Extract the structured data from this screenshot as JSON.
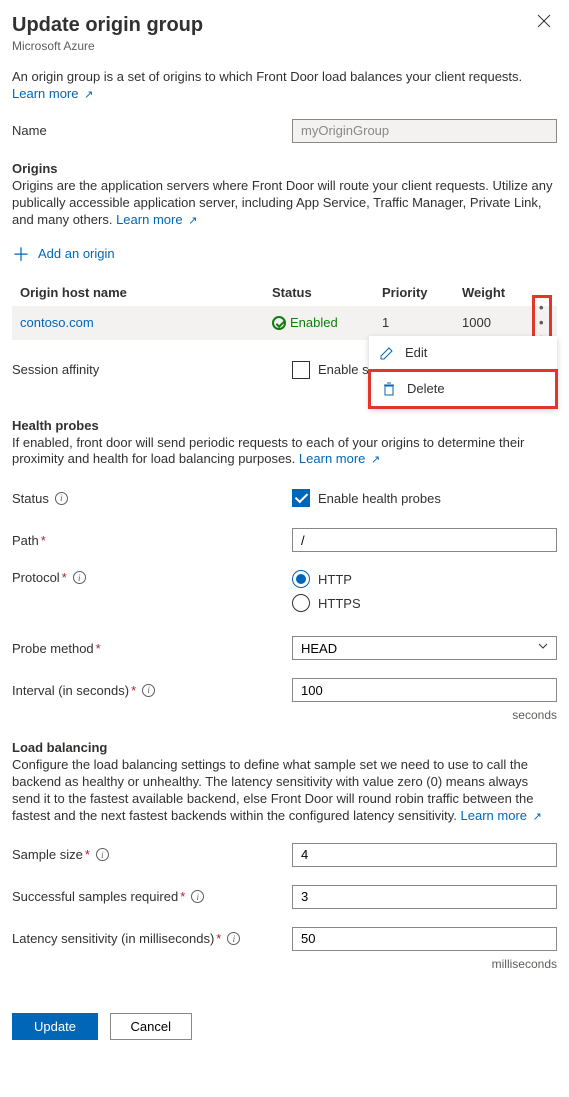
{
  "header": {
    "title": "Update origin group",
    "subtitle": "Microsoft Azure"
  },
  "intro": {
    "text": "An origin group is a set of origins to which Front Door load balances your client requests.",
    "learn_more": "Learn more"
  },
  "name": {
    "label": "Name",
    "value": "myOriginGroup"
  },
  "origins": {
    "title": "Origins",
    "desc": "Origins are the application servers where Front Door will route your client requests. Utilize any publically accessible application server, including App Service, Traffic Manager, Private Link, and many others.",
    "learn_more": "Learn more",
    "add_label": "Add an origin",
    "headers": {
      "host": "Origin host name",
      "status": "Status",
      "priority": "Priority",
      "weight": "Weight"
    },
    "rows": [
      {
        "host": "contoso.com",
        "status": "Enabled",
        "priority": "1",
        "weight": "1000"
      }
    ],
    "menu": {
      "edit": "Edit",
      "delete": "Delete"
    }
  },
  "session_affinity": {
    "label": "Session affinity",
    "checkbox_label_partial": "Enable se"
  },
  "health": {
    "title": "Health probes",
    "desc": "If enabled, front door will send periodic requests to each of your origins to determine their proximity and health for load balancing purposes.",
    "learn_more": "Learn more",
    "status_label": "Status",
    "enable_label": "Enable health probes",
    "path_label": "Path",
    "path_value": "/",
    "protocol_label": "Protocol",
    "protocol_http": "HTTP",
    "protocol_https": "HTTPS",
    "probe_method_label": "Probe method",
    "probe_method_value": "HEAD",
    "interval_label": "Interval (in seconds)",
    "interval_value": "100",
    "interval_unit": "seconds"
  },
  "lb": {
    "title": "Load balancing",
    "desc": "Configure the load balancing settings to define what sample set we need to use to call the backend as healthy or unhealthy. The latency sensitivity with value zero (0) means always send it to the fastest available backend, else Front Door will round robin traffic between the fastest and the next fastest backends within the configured latency sensitivity.",
    "learn_more": "Learn more",
    "sample_label": "Sample size",
    "sample_value": "4",
    "succ_label": "Successful samples required",
    "succ_value": "3",
    "lat_label": "Latency sensitivity (in milliseconds)",
    "lat_value": "50",
    "lat_unit": "milliseconds"
  },
  "footer": {
    "update": "Update",
    "cancel": "Cancel"
  }
}
